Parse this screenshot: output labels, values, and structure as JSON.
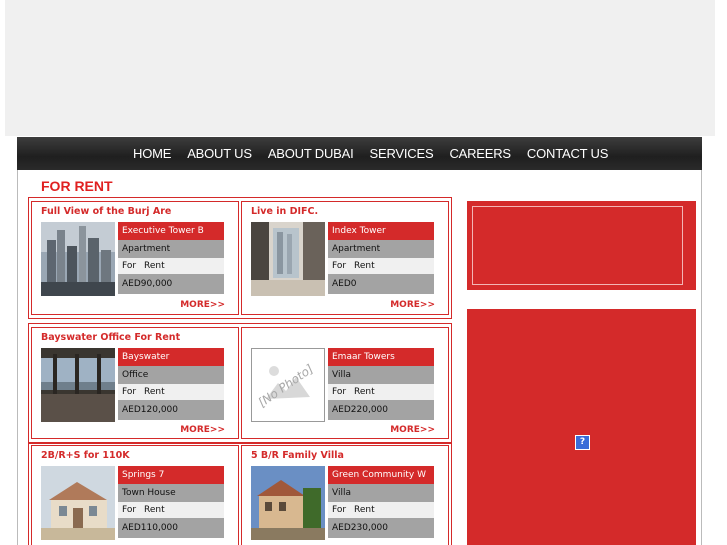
{
  "nav": {
    "items": [
      "HOME",
      "ABOUT US",
      "ABOUT DUBAI",
      "SERVICES",
      "CAREERS",
      "CONTACT US"
    ]
  },
  "section": {
    "title": "FOR RENT"
  },
  "listings": [
    {
      "title": "Full View of the Burj Are",
      "name": "Executive Tower B",
      "type": "Apartment",
      "for_label": "For",
      "status": "Rent",
      "price": "AED90,000",
      "more": "MORE>>"
    },
    {
      "title": "Live in DIFC.",
      "name": "Index Tower",
      "type": "Apartment",
      "for_label": "For",
      "status": "Rent",
      "price": "AED0",
      "more": "MORE>>"
    },
    {
      "title": "Bayswater Office For Rent",
      "name": "Bayswater",
      "type": "Office",
      "for_label": "For",
      "status": "Rent",
      "price": "AED120,000",
      "more": "MORE>>"
    },
    {
      "title": "",
      "name": "Emaar Towers",
      "type": "Villa",
      "for_label": "For",
      "status": "Rent",
      "price": "AED220,000",
      "more": "MORE>>",
      "no_photo_text": "[No Photo]"
    },
    {
      "title": "2B/R+S for 110K",
      "name": "Springs 7",
      "type": "Town House",
      "for_label": "For",
      "status": "Rent",
      "price": "AED110,000"
    },
    {
      "title": "5 B/R Family Villa",
      "name": "Green Community W",
      "type": "Villa",
      "for_label": "For",
      "status": "Rent",
      "price": "AED230,000"
    }
  ],
  "sidebar": {
    "help_icon": "?"
  },
  "colors": {
    "accent": "#d42a2a",
    "nav_bg": "#2a2a2a"
  }
}
